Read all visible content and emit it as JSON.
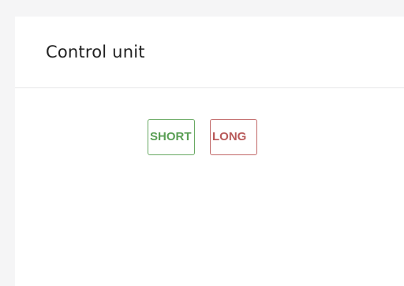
{
  "panel": {
    "title": "Control unit"
  },
  "controls": {
    "short_label": "SHORT",
    "long_label": "LONG",
    "short_color": "#5a9f55",
    "long_color": "#b85a5a"
  }
}
